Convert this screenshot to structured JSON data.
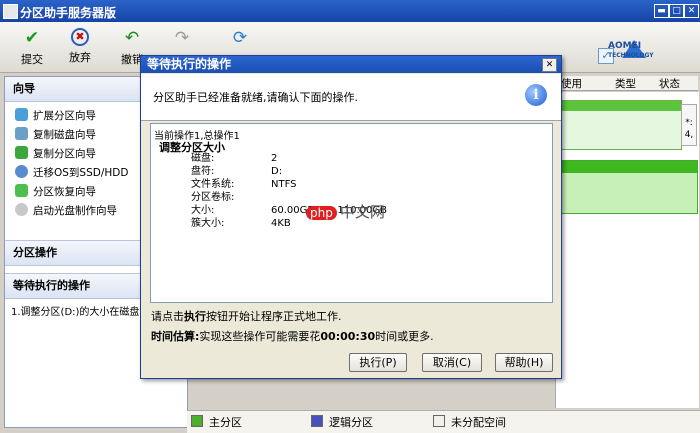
{
  "window": {
    "title": "分区助手服务器版"
  },
  "toolbar": {
    "commit": "提交",
    "discard": "放弃",
    "undo": "撤销",
    "logo_line1": "AOMEI",
    "logo_line2": "TECHNOLOGY"
  },
  "columns": {
    "used": "使用",
    "type": "类型",
    "status": "状态"
  },
  "disk_map": {
    "side_text": "*:",
    "side_text2": "4,"
  },
  "sidebar": {
    "wizard_header": "向导",
    "wizards": [
      {
        "label": "扩展分区向导"
      },
      {
        "label": "复制磁盘向导"
      },
      {
        "label": "复制分区向导"
      },
      {
        "label": "迁移OS到SSD/HDD"
      },
      {
        "label": "分区恢复向导"
      },
      {
        "label": "启动光盘制作向导"
      }
    ],
    "partition_ops_header": "分区操作",
    "pending_header": "等待执行的操作",
    "pending_item": "1.调整分区(D:)的大小在磁盘2..."
  },
  "dialog": {
    "title": "等待执行的操作",
    "message": "分区助手已经准备就绪,请确认下面的操作.",
    "ops_summary": "当前操作1,总操作1",
    "op_title": "调整分区大小",
    "details": [
      {
        "key": "磁盘:",
        "value": "2"
      },
      {
        "key": "盘符:",
        "value": "D:"
      },
      {
        "key": "文件系统:",
        "value": "NTFS"
      },
      {
        "key": "分区卷标:",
        "value": ""
      },
      {
        "key": "大小:",
        "value": "60.00GB => 110.00GB"
      },
      {
        "key": "簇大小:",
        "value": "4KB"
      }
    ],
    "hint_pre": "请点击",
    "hint_bold": "执行",
    "hint_post": "按钮开始让程序正式地工作.",
    "time_label": "时间估算:",
    "time_pre": "实现这些操作可能需要花",
    "time_value": "00:00:30",
    "time_post": "时间或更多.",
    "buttons": {
      "execute": "执行(P)",
      "cancel": "取消(C)",
      "help": "帮助(H)"
    }
  },
  "legend": {
    "primary": "主分区",
    "logical": "逻辑分区",
    "unallocated": "未分配空间"
  },
  "watermark": {
    "badge": "php",
    "text": "中文网"
  },
  "colors": {
    "primary": "#4caf2f",
    "logical": "#4a4fc0",
    "unallocated": "#f2f0e8",
    "titlebar": "#1743a5"
  }
}
